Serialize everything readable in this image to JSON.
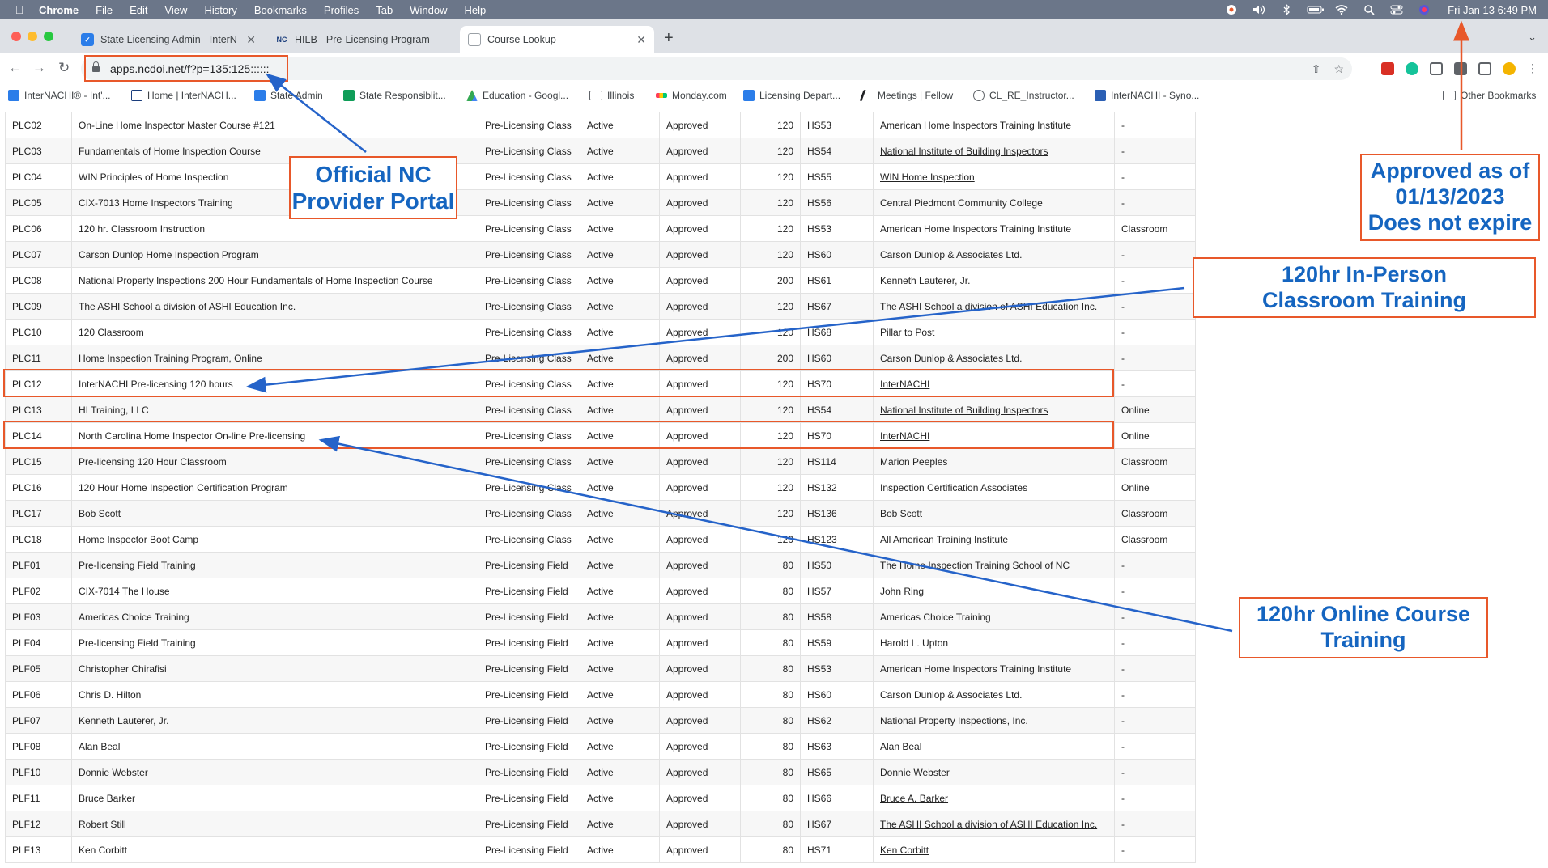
{
  "menubar": {
    "app": "Chrome",
    "items": [
      "File",
      "Edit",
      "View",
      "History",
      "Bookmarks",
      "Profiles",
      "Tab",
      "Window",
      "Help"
    ],
    "clock": "Fri Jan 13  6:49 PM"
  },
  "tabs": [
    {
      "title": "State Licensing Admin - InterN",
      "icon": "check-icon",
      "active": false
    },
    {
      "title": "HILB - Pre-Licensing Program",
      "icon": "nc-icon",
      "active": false
    },
    {
      "title": "Course Lookup",
      "icon": "doc-icon",
      "active": true
    }
  ],
  "tab_icon_labels": {
    "nc": "NC"
  },
  "omnibox": {
    "url": "apps.ncdoi.net/f?p=135:125::::::"
  },
  "bookmarks": [
    {
      "label": "InterNACHI® - Int'..."
    },
    {
      "label": "Home | InterNACH..."
    },
    {
      "label": "State Admin"
    },
    {
      "label": "State Responsiblit..."
    },
    {
      "label": "Education - Googl..."
    },
    {
      "label": "Illinois"
    },
    {
      "label": "Monday.com"
    },
    {
      "label": "Licensing Depart..."
    },
    {
      "label": "Meetings | Fellow"
    },
    {
      "label": "CL_RE_Instructor..."
    },
    {
      "label": "InterNACHI - Syno..."
    },
    {
      "label": "Other Bookmarks"
    }
  ],
  "table_rows": [
    {
      "id": "PLC02",
      "name": "On-Line Home Inspector Master Course #121",
      "type": "Pre-Licensing Class",
      "status": "Active",
      "approval": "Approved",
      "hours": "120",
      "code": "HS53",
      "provider": "American Home Inspectors Training Institute",
      "link": false,
      "delivery": "-"
    },
    {
      "id": "PLC03",
      "name": "Fundamentals of Home Inspection Course",
      "type": "Pre-Licensing Class",
      "status": "Active",
      "approval": "Approved",
      "hours": "120",
      "code": "HS54",
      "provider": "National Institute of Building Inspectors",
      "link": true,
      "delivery": "-"
    },
    {
      "id": "PLC04",
      "name": "WIN Principles of Home Inspection",
      "type": "Pre-Licensing Class",
      "status": "Active",
      "approval": "Approved",
      "hours": "120",
      "code": "HS55",
      "provider": "WIN Home Inspection",
      "link": true,
      "delivery": "-"
    },
    {
      "id": "PLC05",
      "name": "CIX-7013 Home Inspectors Training",
      "type": "Pre-Licensing Class",
      "status": "Active",
      "approval": "Approved",
      "hours": "120",
      "code": "HS56",
      "provider": "Central Piedmont Community College",
      "link": false,
      "delivery": "-"
    },
    {
      "id": "PLC06",
      "name": "120 hr. Classroom Instruction",
      "type": "Pre-Licensing Class",
      "status": "Active",
      "approval": "Approved",
      "hours": "120",
      "code": "HS53",
      "provider": "American Home Inspectors Training Institute",
      "link": false,
      "delivery": "Classroom"
    },
    {
      "id": "PLC07",
      "name": "Carson Dunlop Home Inspection Program",
      "type": "Pre-Licensing Class",
      "status": "Active",
      "approval": "Approved",
      "hours": "120",
      "code": "HS60",
      "provider": "Carson Dunlop & Associates Ltd.",
      "link": false,
      "delivery": "-"
    },
    {
      "id": "PLC08",
      "name": "National Property Inspections 200 Hour Fundamentals of Home Inspection Course",
      "type": "Pre-Licensing Class",
      "status": "Active",
      "approval": "Approved",
      "hours": "200",
      "code": "HS61",
      "provider": "Kenneth Lauterer, Jr.",
      "link": false,
      "delivery": "-"
    },
    {
      "id": "PLC09",
      "name": "The ASHI School a division of ASHI Education Inc.",
      "type": "Pre-Licensing Class",
      "status": "Active",
      "approval": "Approved",
      "hours": "120",
      "code": "HS67",
      "provider": "The ASHI School a division of ASHI Education Inc.",
      "link": true,
      "delivery": "-"
    },
    {
      "id": "PLC10",
      "name": "120 Classroom",
      "type": "Pre-Licensing Class",
      "status": "Active",
      "approval": "Approved",
      "hours": "120",
      "code": "HS68",
      "provider": "Pillar to Post",
      "link": true,
      "delivery": "-"
    },
    {
      "id": "PLC11",
      "name": "Home Inspection Training Program, Online",
      "type": "Pre-Licensing Class",
      "status": "Active",
      "approval": "Approved",
      "hours": "200",
      "code": "HS60",
      "provider": "Carson Dunlop & Associates Ltd.",
      "link": false,
      "delivery": "-"
    },
    {
      "id": "PLC12",
      "name": "InterNACHI Pre-licensing 120 hours",
      "type": "Pre-Licensing Class",
      "status": "Active",
      "approval": "Approved",
      "hours": "120",
      "code": "HS70",
      "provider": "InterNACHI",
      "link": true,
      "delivery": "-"
    },
    {
      "id": "PLC13",
      "name": "HI Training, LLC",
      "type": "Pre-Licensing Class",
      "status": "Active",
      "approval": "Approved",
      "hours": "120",
      "code": "HS54",
      "provider": "National Institute of Building Inspectors",
      "link": true,
      "delivery": "Online"
    },
    {
      "id": "PLC14",
      "name": "North Carolina Home Inspector On-line Pre-licensing",
      "type": "Pre-Licensing Class",
      "status": "Active",
      "approval": "Approved",
      "hours": "120",
      "code": "HS70",
      "provider": "InterNACHI",
      "link": true,
      "delivery": "Online"
    },
    {
      "id": "PLC15",
      "name": "Pre-licensing 120 Hour Classroom",
      "type": "Pre-Licensing Class",
      "status": "Active",
      "approval": "Approved",
      "hours": "120",
      "code": "HS114",
      "provider": "Marion Peeples",
      "link": false,
      "delivery": "Classroom"
    },
    {
      "id": "PLC16",
      "name": "120 Hour Home Inspection Certification Program",
      "type": "Pre-Licensing Class",
      "status": "Active",
      "approval": "Approved",
      "hours": "120",
      "code": "HS132",
      "provider": "Inspection Certification Associates",
      "link": false,
      "delivery": "Online"
    },
    {
      "id": "PLC17",
      "name": "Bob Scott",
      "type": "Pre-Licensing Class",
      "status": "Active",
      "approval": "Approved",
      "hours": "120",
      "code": "HS136",
      "provider": "Bob Scott",
      "link": false,
      "delivery": "Classroom"
    },
    {
      "id": "PLC18",
      "name": "Home Inspector Boot Camp",
      "type": "Pre-Licensing Class",
      "status": "Active",
      "approval": "Approved",
      "hours": "120",
      "code": "HS123",
      "provider": "All American Training Institute",
      "link": false,
      "delivery": "Classroom"
    },
    {
      "id": "PLF01",
      "name": "Pre-licensing Field Training",
      "type": "Pre-Licensing Field",
      "status": "Active",
      "approval": "Approved",
      "hours": "80",
      "code": "HS50",
      "provider": "The Home Inspection Training School of NC",
      "link": false,
      "delivery": "-"
    },
    {
      "id": "PLF02",
      "name": "CIX-7014 The House",
      "type": "Pre-Licensing Field",
      "status": "Active",
      "approval": "Approved",
      "hours": "80",
      "code": "HS57",
      "provider": "John Ring",
      "link": false,
      "delivery": "-"
    },
    {
      "id": "PLF03",
      "name": "Americas Choice Training",
      "type": "Pre-Licensing Field",
      "status": "Active",
      "approval": "Approved",
      "hours": "80",
      "code": "HS58",
      "provider": "Americas Choice Training",
      "link": false,
      "delivery": "-"
    },
    {
      "id": "PLF04",
      "name": "Pre-licensing Field Training",
      "type": "Pre-Licensing Field",
      "status": "Active",
      "approval": "Approved",
      "hours": "80",
      "code": "HS59",
      "provider": "Harold L. Upton",
      "link": false,
      "delivery": "-"
    },
    {
      "id": "PLF05",
      "name": "Christopher Chirafisi",
      "type": "Pre-Licensing Field",
      "status": "Active",
      "approval": "Approved",
      "hours": "80",
      "code": "HS53",
      "provider": "American Home Inspectors Training Institute",
      "link": false,
      "delivery": "-"
    },
    {
      "id": "PLF06",
      "name": "Chris D. Hilton",
      "type": "Pre-Licensing Field",
      "status": "Active",
      "approval": "Approved",
      "hours": "80",
      "code": "HS60",
      "provider": "Carson Dunlop & Associates Ltd.",
      "link": false,
      "delivery": "-"
    },
    {
      "id": "PLF07",
      "name": "Kenneth Lauterer, Jr.",
      "type": "Pre-Licensing Field",
      "status": "Active",
      "approval": "Approved",
      "hours": "80",
      "code": "HS62",
      "provider": "National Property Inspections, Inc.",
      "link": false,
      "delivery": "-"
    },
    {
      "id": "PLF08",
      "name": "Alan Beal",
      "type": "Pre-Licensing Field",
      "status": "Active",
      "approval": "Approved",
      "hours": "80",
      "code": "HS63",
      "provider": "Alan Beal",
      "link": false,
      "delivery": "-"
    },
    {
      "id": "PLF10",
      "name": "Donnie Webster",
      "type": "Pre-Licensing Field",
      "status": "Active",
      "approval": "Approved",
      "hours": "80",
      "code": "HS65",
      "provider": "Donnie Webster",
      "link": false,
      "delivery": "-"
    },
    {
      "id": "PLF11",
      "name": "Bruce Barker",
      "type": "Pre-Licensing Field",
      "status": "Active",
      "approval": "Approved",
      "hours": "80",
      "code": "HS66",
      "provider": "Bruce A. Barker",
      "link": true,
      "delivery": "-"
    },
    {
      "id": "PLF12",
      "name": "Robert Still",
      "type": "Pre-Licensing Field",
      "status": "Active",
      "approval": "Approved",
      "hours": "80",
      "code": "HS67",
      "provider": "The ASHI School a division of ASHI Education Inc.",
      "link": true,
      "delivery": "-"
    },
    {
      "id": "PLF13",
      "name": "Ken Corbitt",
      "type": "Pre-Licensing Field",
      "status": "Active",
      "approval": "Approved",
      "hours": "80",
      "code": "HS71",
      "provider": "Ken Corbitt",
      "link": true,
      "delivery": "-"
    }
  ],
  "annotations": {
    "portal": {
      "line1": "Official NC",
      "line2": "Provider Portal"
    },
    "approved": {
      "line1": "Approved as of",
      "line2": "01/13/2023",
      "line3": "Does not expire"
    },
    "inperson": {
      "line1": "120hr In-Person",
      "line2": "Classroom Training"
    },
    "online": {
      "line1": "120hr Online Course",
      "line2": "Training"
    }
  },
  "colors": {
    "annotation_border": "#e8582a",
    "annotation_text": "#1565c0",
    "arrow_blue": "#2563c9",
    "menubar": "#6b7689"
  }
}
